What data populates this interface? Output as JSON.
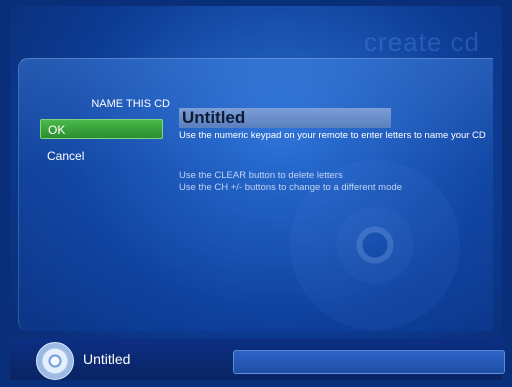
{
  "header": {
    "ghost_title": "create cd"
  },
  "naming": {
    "label": "NAME THIS CD",
    "field_value": "Untitled",
    "ok_label": "OK",
    "cancel_label": "Cancel"
  },
  "help": {
    "line1": "Use the numeric keypad on your remote to enter letters to name your CD",
    "line2": "Use the CLEAR button to delete letters",
    "line3": "Use the CH +/- buttons to change to a different mode"
  },
  "status": {
    "cd_title": "Untitled",
    "icon": "cd-disc-icon"
  },
  "colors": {
    "background": "#0c3b93",
    "accent_green": "#2c8d2f",
    "field_bg": "#6f90cc"
  }
}
